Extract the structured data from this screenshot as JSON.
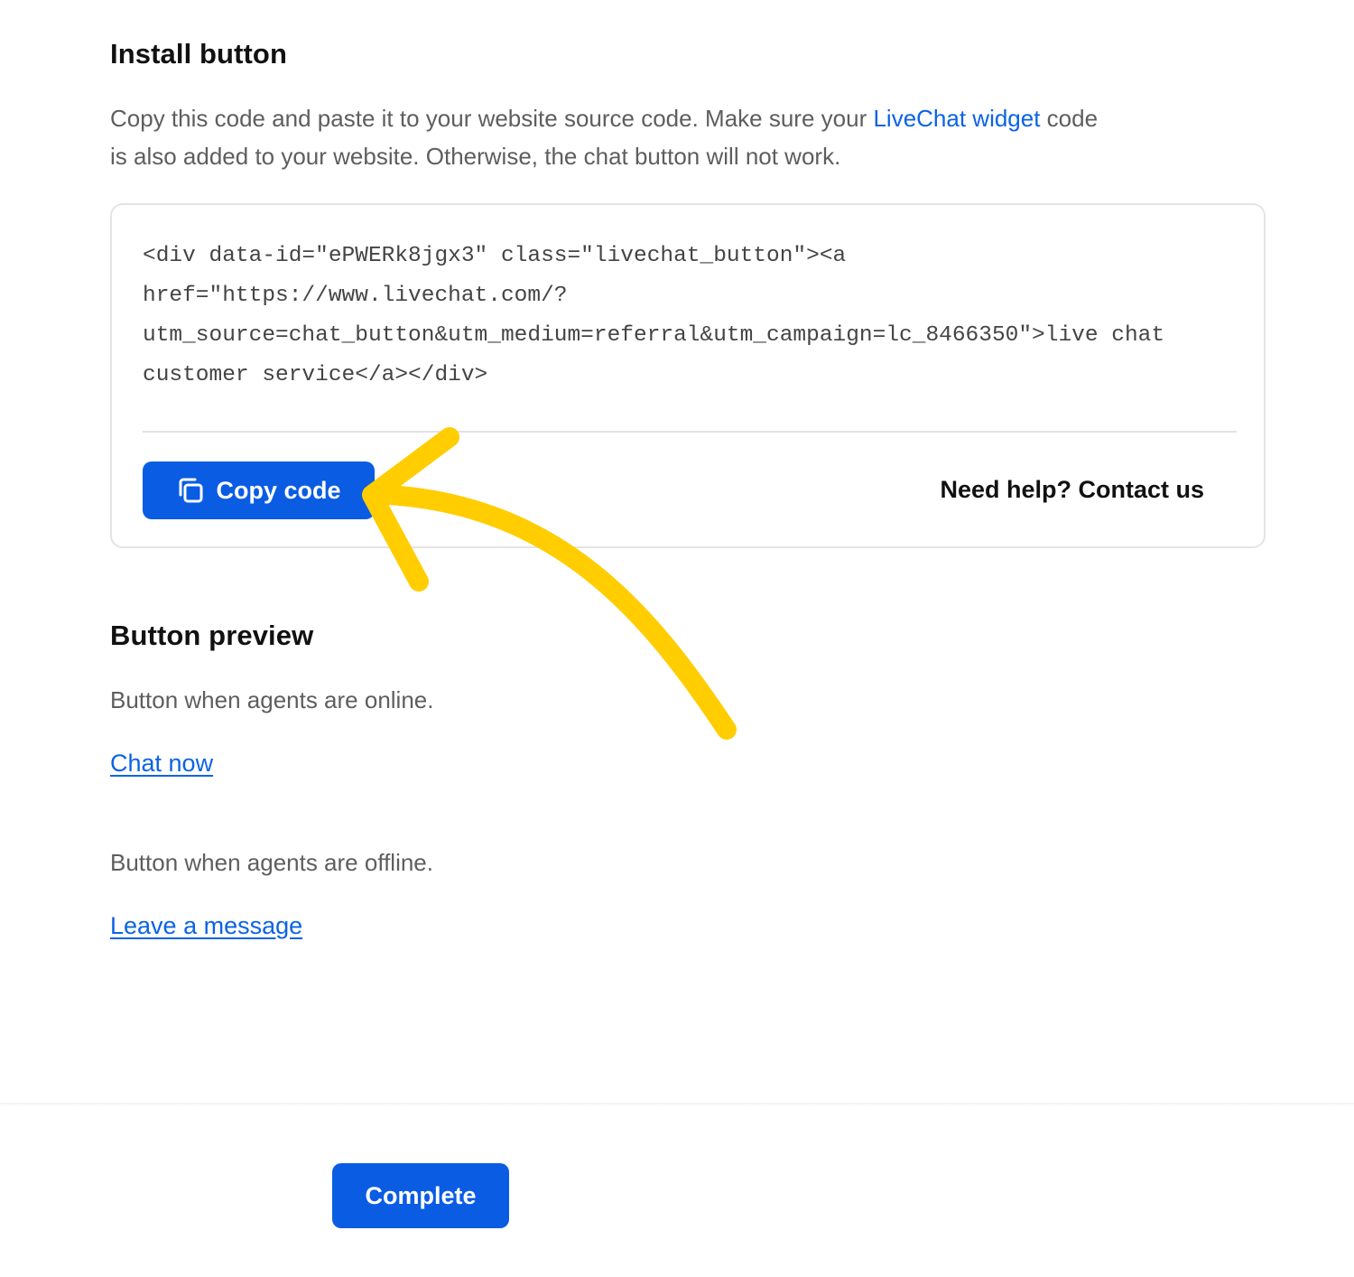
{
  "install": {
    "title": "Install button",
    "description_part1": "Copy this code and paste it to your website source code. Make sure your ",
    "description_link": "LiveChat widget",
    "description_part2": " code\nis also added to your website. Otherwise, the chat button will not work.",
    "code_lines": [
      "<div data-id=\"ePWERk8jgx3\" class=\"livechat_button\"><a",
      "href=\"https://www.livechat.com/?",
      "utm_source=chat_button&utm_medium=referral&utm_campaign=lc_8466350\">live chat",
      "customer service</a></div>"
    ],
    "copy_button_label": "Copy code",
    "help_link_label": "Need help? Contact us"
  },
  "preview": {
    "title": "Button preview",
    "online_caption": "Button when agents are online.",
    "online_link": "Chat now",
    "offline_caption": "Button when agents are offline.",
    "offline_link": "Leave a message"
  },
  "footer": {
    "complete_button_label": "Complete"
  },
  "colors": {
    "accent": "#0a5ce3",
    "link": "#0b63e5",
    "annotation_arrow": "#ffcd00"
  },
  "icons": {
    "copy": "copy-icon",
    "annotation": "curved-arrow-annotation"
  }
}
